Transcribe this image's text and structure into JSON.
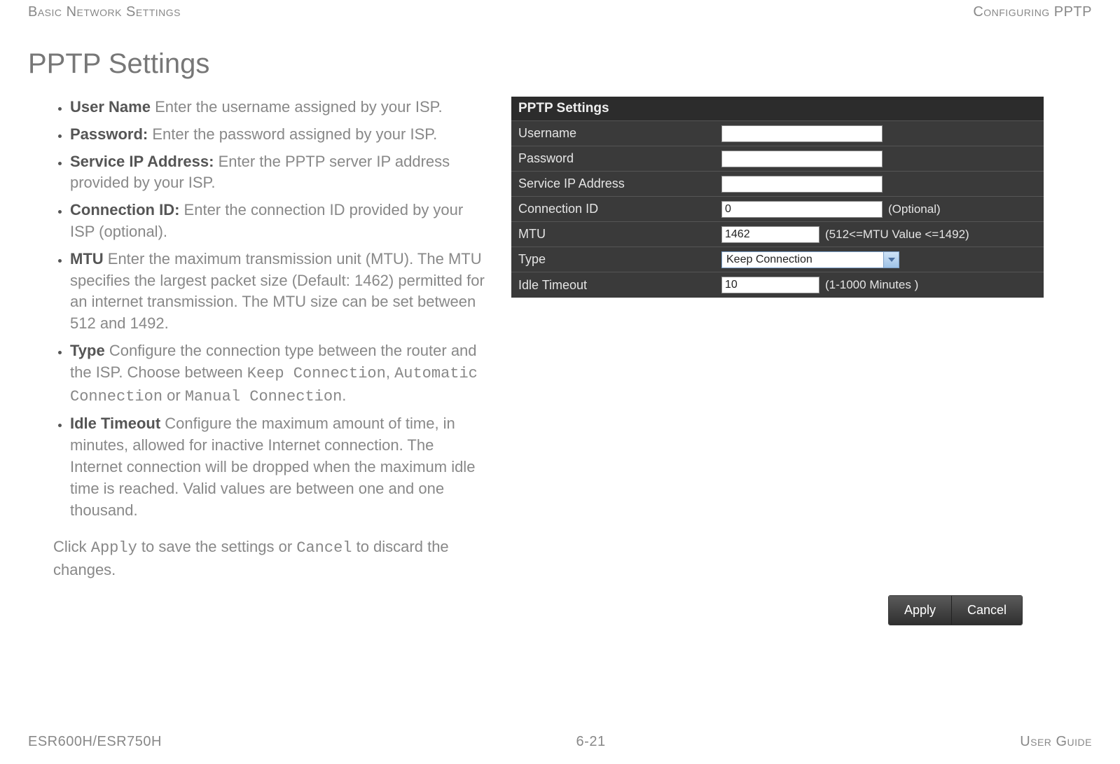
{
  "header": {
    "left": "Basic Network Settings",
    "right": "Configuring PPTP"
  },
  "footer": {
    "left": "ESR600H/ESR750H",
    "center": "6-21",
    "right": "User Guide"
  },
  "section_title": "PPTP Settings",
  "descriptions": [
    {
      "term": "User Name",
      "text": "  Enter the username assigned by your ISP."
    },
    {
      "term": "Password:",
      "text": " Enter the password assigned by your ISP."
    },
    {
      "term": "Service IP Address:",
      "text": " Enter the PPTP server IP address provided by your ISP."
    },
    {
      "term": "Connection ID:",
      "text": " Enter the connection ID provided by your ISP (optional)."
    },
    {
      "term": "MTU",
      "text": "  Enter the maximum transmission unit (MTU). The MTU specifies the largest packet size (Default: 1462) permitted for an internet transmission. The MTU size can be set between 512 and 1492."
    },
    {
      "term": "Type",
      "text_pre": "  Configure the connection type between the router and the ISP. Choose between ",
      "mono1": "Keep Connection",
      "mid1": ", ",
      "mono2": "Automatic Connection",
      "mid2": " or ",
      "mono3": "Manual Connection",
      "post": "."
    },
    {
      "term": "Idle Timeout",
      "text": "  Configure the maximum amount of time, in minutes, allowed for inactive Internet connection. The Internet connection will be dropped when the maximum idle time is reached. Valid values are between one and one thousand."
    }
  ],
  "closing": {
    "pre": "Click ",
    "apply": "Apply",
    "mid": " to save the settings or ",
    "cancel": "Cancel",
    "post": " to discard the changes."
  },
  "panel": {
    "title": "PPTP Settings",
    "rows": {
      "username_label": "Username",
      "username_value": "",
      "password_label": "Password",
      "password_value": "",
      "serviceip_label": "Service IP Address",
      "serviceip_value": "",
      "connid_label": "Connection ID",
      "connid_value": "0",
      "connid_hint": "(Optional)",
      "mtu_label": "MTU",
      "mtu_value": "1462",
      "mtu_hint": "(512<=MTU Value <=1492)",
      "type_label": "Type",
      "type_value": "Keep Connection",
      "idle_label": "Idle Timeout",
      "idle_value": "10",
      "idle_hint": "(1-1000 Minutes )"
    }
  },
  "buttons": {
    "apply": "Apply",
    "cancel": "Cancel"
  }
}
